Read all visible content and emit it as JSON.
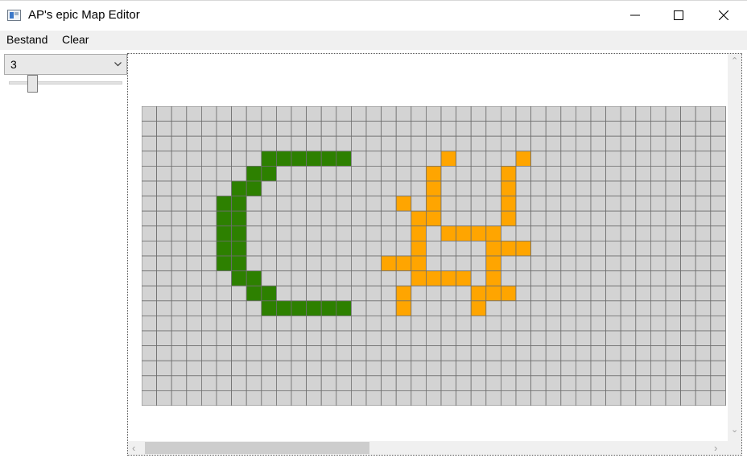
{
  "window": {
    "title": "AP's epic Map Editor"
  },
  "menu": {
    "items": [
      "Bestand",
      "Clear"
    ]
  },
  "tools": {
    "combo_value": "3",
    "slider_value": 0.18
  },
  "map": {
    "cols": 39,
    "rows": 20,
    "colors": {
      "empty": "#d3d3d3",
      "grid_line": "#6e6e6e",
      "green": "#2d8000",
      "orange": "#ffa500"
    },
    "green_cells": [
      [
        8,
        3
      ],
      [
        9,
        3
      ],
      [
        10,
        3
      ],
      [
        11,
        3
      ],
      [
        12,
        3
      ],
      [
        13,
        3
      ],
      [
        7,
        4
      ],
      [
        8,
        4
      ],
      [
        6,
        5
      ],
      [
        7,
        5
      ],
      [
        5,
        6
      ],
      [
        6,
        6
      ],
      [
        5,
        7
      ],
      [
        6,
        7
      ],
      [
        5,
        8
      ],
      [
        6,
        8
      ],
      [
        5,
        9
      ],
      [
        6,
        9
      ],
      [
        5,
        10
      ],
      [
        6,
        10
      ],
      [
        6,
        11
      ],
      [
        7,
        11
      ],
      [
        7,
        12
      ],
      [
        8,
        12
      ],
      [
        8,
        13
      ],
      [
        9,
        13
      ],
      [
        10,
        13
      ],
      [
        11,
        13
      ],
      [
        12,
        13
      ],
      [
        13,
        13
      ]
    ],
    "orange_cells": [
      [
        20,
        3
      ],
      [
        25,
        3
      ],
      [
        19,
        4
      ],
      [
        24,
        4
      ],
      [
        19,
        5
      ],
      [
        24,
        5
      ],
      [
        17,
        6
      ],
      [
        19,
        6
      ],
      [
        24,
        6
      ],
      [
        18,
        7
      ],
      [
        19,
        7
      ],
      [
        24,
        7
      ],
      [
        18,
        8
      ],
      [
        20,
        8
      ],
      [
        21,
        8
      ],
      [
        22,
        8
      ],
      [
        23,
        8
      ],
      [
        18,
        9
      ],
      [
        23,
        9
      ],
      [
        24,
        9
      ],
      [
        25,
        9
      ],
      [
        16,
        10
      ],
      [
        17,
        10
      ],
      [
        18,
        10
      ],
      [
        23,
        10
      ],
      [
        18,
        11
      ],
      [
        19,
        11
      ],
      [
        20,
        11
      ],
      [
        21,
        11
      ],
      [
        23,
        11
      ],
      [
        17,
        12
      ],
      [
        22,
        12
      ],
      [
        23,
        12
      ],
      [
        24,
        12
      ],
      [
        17,
        13
      ],
      [
        22,
        13
      ]
    ]
  }
}
